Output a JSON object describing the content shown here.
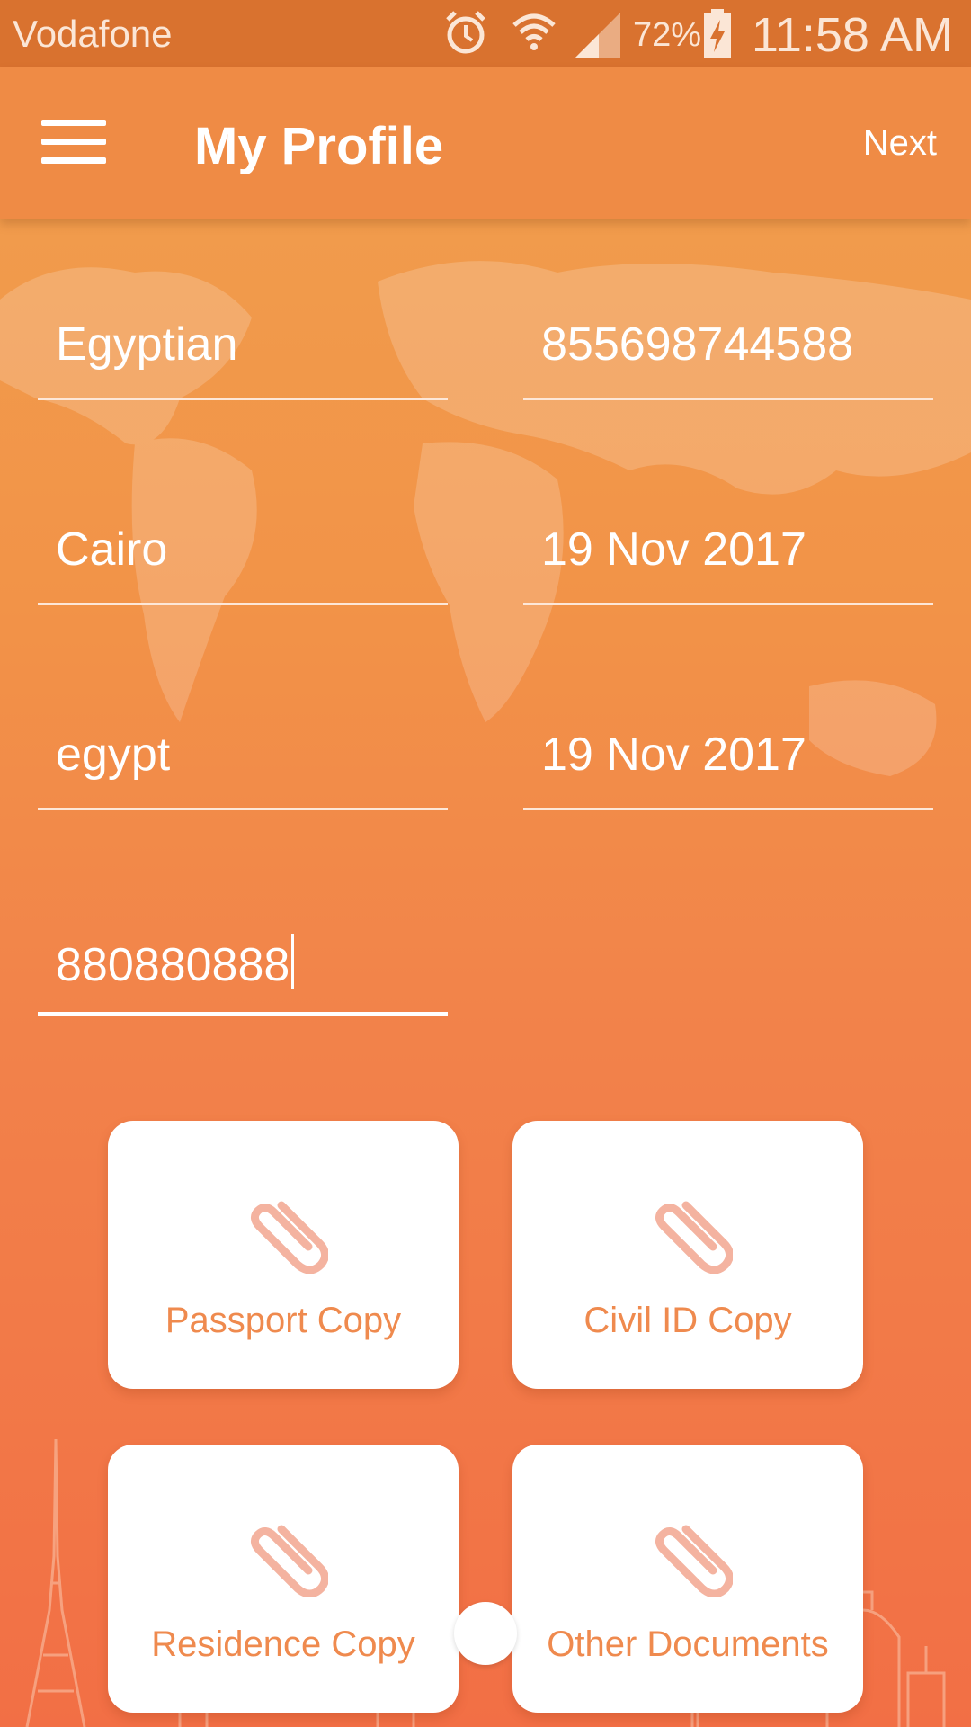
{
  "status_bar": {
    "carrier": "Vodafone",
    "battery": "72%",
    "time": "11:58 AM",
    "icons": [
      "alarm-icon",
      "wifi-icon",
      "signal-icon",
      "battery-charging-icon"
    ]
  },
  "app_bar": {
    "title": "My Profile",
    "next_label": "Next",
    "menu_icon": "hamburger-menu-icon"
  },
  "form": {
    "nationality": "Egyptian",
    "id_number": "855698744588",
    "city": "Cairo",
    "date_1": "19 Nov 2017",
    "country": "egypt",
    "date_2": "19 Nov 2017",
    "phone": "880880888"
  },
  "documents": [
    {
      "label": "Passport Copy",
      "icon": "paperclip-icon"
    },
    {
      "label": "Civil ID Copy",
      "icon": "paperclip-icon"
    },
    {
      "label": "Residence Copy",
      "icon": "paperclip-icon"
    },
    {
      "label": "Other Documents",
      "icon": "paperclip-icon"
    }
  ],
  "colors": {
    "status_bar": "#d9722f",
    "app_bar": "#ef8b45",
    "accent": "#ef8a4e",
    "clip": "#f4b3a0"
  }
}
